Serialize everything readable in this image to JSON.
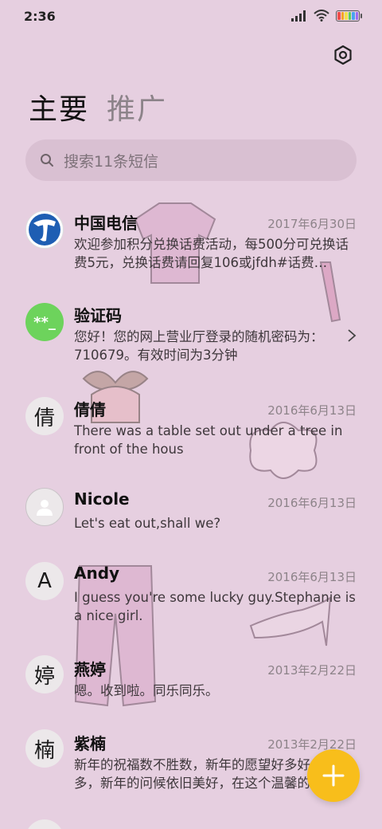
{
  "status_bar": {
    "time": "2:36"
  },
  "tabs": {
    "primary": "主要",
    "secondary": "推广"
  },
  "search": {
    "placeholder": "搜索11条短信"
  },
  "messages": [
    {
      "name": "中国电信",
      "date": "2017年6月30日",
      "body": "欢迎参加积分兑换话费活动，每500分可兑换话费5元，兑换话费请回复106或jfdh#话费…"
    },
    {
      "name": "验证码",
      "date": "",
      "body": "您好！您的网上营业厅登录的随机密码为：710679。有效时间为3分钟",
      "avatar_text": "**_"
    },
    {
      "name": "倩倩",
      "date": "2016年6月13日",
      "body": "There was a table set out under a tree in front of the hous",
      "avatar_text": "倩"
    },
    {
      "name": "Nicole",
      "date": "2016年6月13日",
      "body": "Let's eat out,shall we?"
    },
    {
      "name": "Andy",
      "date": "2016年6月13日",
      "body": "I guess you're some lucky guy.Stephanie is a nice girl.",
      "avatar_text": "A"
    },
    {
      "name": "燕婷",
      "date": "2013年2月22日",
      "body": "嗯。收到啦。同乐同乐。",
      "avatar_text": "婷"
    },
    {
      "name": "紫楠",
      "date": "2013年2月22日",
      "body": "新年的祝福数不胜数，新年的愿望好多好多，新年的问候依旧美好，在这个温馨的时刻",
      "avatar_text": "楠"
    }
  ],
  "colors": {
    "background": "#E6CFE0",
    "fab": "#F8BE1B",
    "verification_avatar": "#6DD35C",
    "telecom_blue": "#1E5EB3"
  },
  "icons": {
    "settings": "gear-icon",
    "search": "search-icon",
    "fab": "plus-icon",
    "chevron": "chevron-right-icon",
    "contact": "person-icon"
  }
}
